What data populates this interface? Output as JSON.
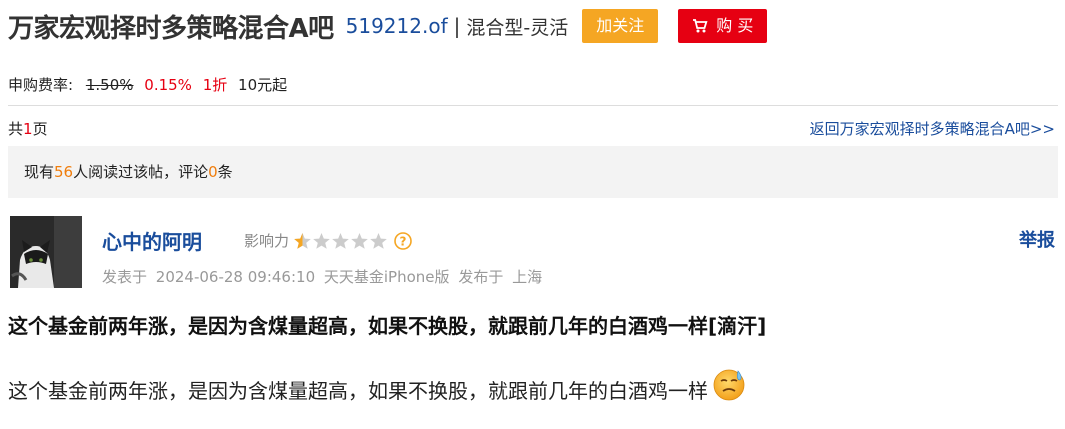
{
  "header": {
    "title": "万家宏观择时多策略混合A吧",
    "code": "519212.of",
    "separator": "|",
    "fund_type": "混合型-灵活",
    "follow_label": "加关注",
    "buy_label": "购 买"
  },
  "fee": {
    "label": "申购费率:",
    "original_rate": "1.50%",
    "discount_rate": "0.15%",
    "discount": "1折",
    "min_amount": "10元起"
  },
  "pager": {
    "prefix": "共",
    "pages": "1",
    "suffix": "页"
  },
  "back_link": "返回万家宏观择时多策略混合A吧>>",
  "read_bar": {
    "prefix": "现有",
    "readers": "56",
    "middle": "人阅读过该帖，评论",
    "comments": "0",
    "suffix": "条"
  },
  "post": {
    "username": "心中的阿明",
    "influence_label": "影响力",
    "influence_stars": 0.5,
    "report_label": "举报",
    "posted_label": "发表于",
    "datetime": "2024-06-28 09:46:10",
    "client": "天天基金iPhone版",
    "location_label": "发布于",
    "location": "上海",
    "title": "这个基金前两年涨，是因为含煤量超高，如果不换股，就跟前几年的白酒鸡一样[滴汗]",
    "body": "这个基金前两年涨，是因为含煤量超高，如果不换股，就跟前几年的白酒鸡一样",
    "emoji": "sweat-emoji"
  },
  "colors": {
    "link_blue": "#1a4d9c",
    "follow_orange": "#f5a623",
    "buy_red": "#e60012",
    "highlight_red": "#e60012",
    "count_orange": "#f07d0c",
    "star_gold": "#f5a623",
    "star_gray": "#cccccc"
  }
}
